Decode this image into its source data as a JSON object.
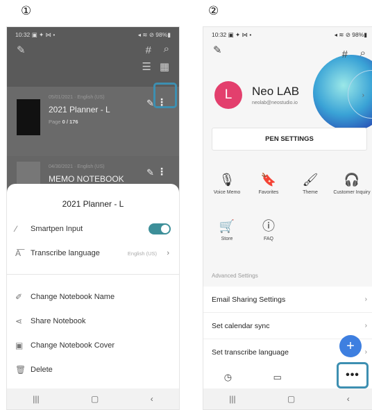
{
  "markers": {
    "one": "①",
    "two": "②"
  },
  "status": {
    "time": "10:32",
    "left_icons": "▣ ✦ ⋈ •",
    "right_icons": "◂ ≋ ⊘ 98%▮"
  },
  "icons": {
    "pen": "✎",
    "hash": "#",
    "search": "⌕",
    "list": "☰",
    "grid": "▦",
    "kebab": "⋮",
    "chevron": "›",
    "nav_recent": "|||",
    "nav_home": "▢",
    "nav_back": "‹"
  },
  "screen1": {
    "notebooks": [
      {
        "date": "05/01/2021",
        "lang": "English (US)",
        "title": "2021 Planner - L",
        "page_label": "Page",
        "page_value": "0 / 176"
      },
      {
        "date": "04/30/2021",
        "lang": "English (US)",
        "title": "MEMO NOTEBOOK"
      }
    ],
    "sheet": {
      "title": "2021 Planner - L",
      "smartpen_input": "Smartpen Input",
      "transcribe_language": "Transcribe language",
      "transcribe_value": "English (US)",
      "change_name": "Change Notebook Name",
      "share": "Share Notebook",
      "change_cover": "Change Notebook Cover",
      "delete": "Delete"
    }
  },
  "screen2": {
    "user": {
      "initial": "L",
      "name": "Neo LAB",
      "email": "neolab@neostudio.io"
    },
    "pen_settings": "PEN SETTINGS",
    "features": [
      {
        "label": "Voice Memo",
        "icon": "🎙"
      },
      {
        "label": "Favorites",
        "icon": "🔖"
      },
      {
        "label": "Theme",
        "icon": "🖌"
      },
      {
        "label": "Customer Inquiry",
        "icon": "🎧"
      },
      {
        "label": "Store",
        "icon": "🛒"
      },
      {
        "label": "FAQ",
        "icon": "ⓘ"
      }
    ],
    "advanced_label": "Advanced Settings",
    "settings": [
      {
        "label": "Email Sharing Settings"
      },
      {
        "label": "Set calendar sync"
      },
      {
        "label": "Set transcribe language"
      }
    ],
    "fab": "+",
    "tabs": {
      "history": "◷",
      "notebooks": "▭",
      "more": "•••"
    }
  }
}
